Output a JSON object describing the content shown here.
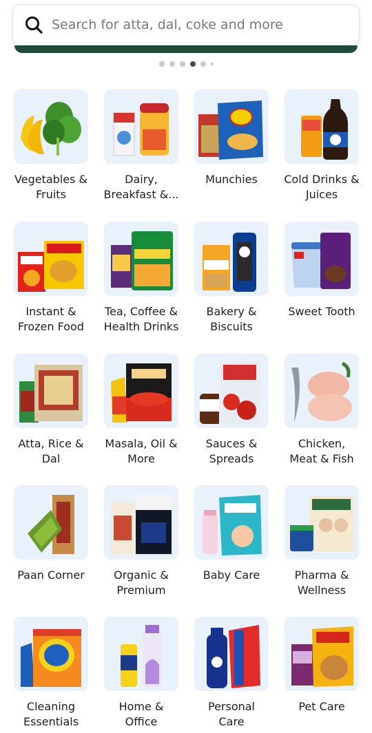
{
  "search": {
    "placeholder": "Search for atta, dal, coke and more",
    "icon": "search-icon"
  },
  "carousel": {
    "dot_count": 6,
    "active_index": 3
  },
  "colors": {
    "tile_bg": "#e9f1fb",
    "banner": "#1f4b3a",
    "text": "#1e1e1e"
  },
  "categories": [
    {
      "label": "Vegetables &\nFruits"
    },
    {
      "label": "Dairy,\nBreakfast &..."
    },
    {
      "label": "Munchies"
    },
    {
      "label": "Cold Drinks &\nJuices"
    },
    {
      "label": "Instant &\nFrozen Food"
    },
    {
      "label": "Tea, Coffee &\nHealth Drinks"
    },
    {
      "label": "Bakery &\nBiscuits"
    },
    {
      "label": "Sweet Tooth"
    },
    {
      "label": "Atta, Rice &\nDal"
    },
    {
      "label": "Masala, Oil &\nMore"
    },
    {
      "label": "Sauces &\nSpreads"
    },
    {
      "label": "Chicken,\nMeat & Fish"
    },
    {
      "label": "Paan Corner"
    },
    {
      "label": "Organic &\nPremium"
    },
    {
      "label": "Baby Care"
    },
    {
      "label": "Pharma &\nWellness"
    },
    {
      "label": "Cleaning\nEssentials"
    },
    {
      "label": "Home &\nOffice"
    },
    {
      "label": "Personal\nCare"
    },
    {
      "label": "Pet Care"
    }
  ]
}
